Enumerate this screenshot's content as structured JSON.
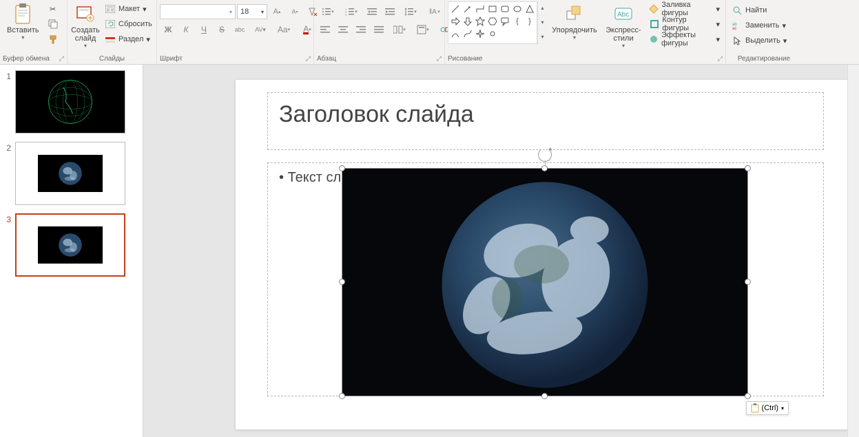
{
  "ribbon": {
    "clipboard": {
      "label": "Буфер обмена",
      "paste": "Вставить",
      "cut": "",
      "copy": "",
      "format_painter": ""
    },
    "slides": {
      "label": "Слайды",
      "new_slide": "Создать слайд",
      "layout": "Макет",
      "reset": "Сбросить",
      "section": "Раздел"
    },
    "font": {
      "label": "Шрифт",
      "size": "18",
      "bold": "Ж",
      "italic": "К",
      "underline": "Ч",
      "strike": "S",
      "shadow": "abc",
      "spacing": "AV",
      "case": "Aa",
      "font_color": "A"
    },
    "paragraph": {
      "label": "Абзац"
    },
    "drawing": {
      "label": "Рисование",
      "arrange": "Упорядочить",
      "quick_styles": "Экспресс-стили",
      "fill": "Заливка фигуры",
      "outline": "Контур фигуры",
      "effects": "Эффекты фигуры"
    },
    "editing": {
      "label": "Редактирование",
      "find": "Найти",
      "replace": "Заменить",
      "select": "Выделить"
    }
  },
  "thumbnails": [
    {
      "num": "1"
    },
    {
      "num": "2"
    },
    {
      "num": "3"
    }
  ],
  "slide": {
    "title_placeholder": "Заголовок слайда",
    "body_placeholder": "Текст сл"
  },
  "paste_options": "(Ctrl)"
}
